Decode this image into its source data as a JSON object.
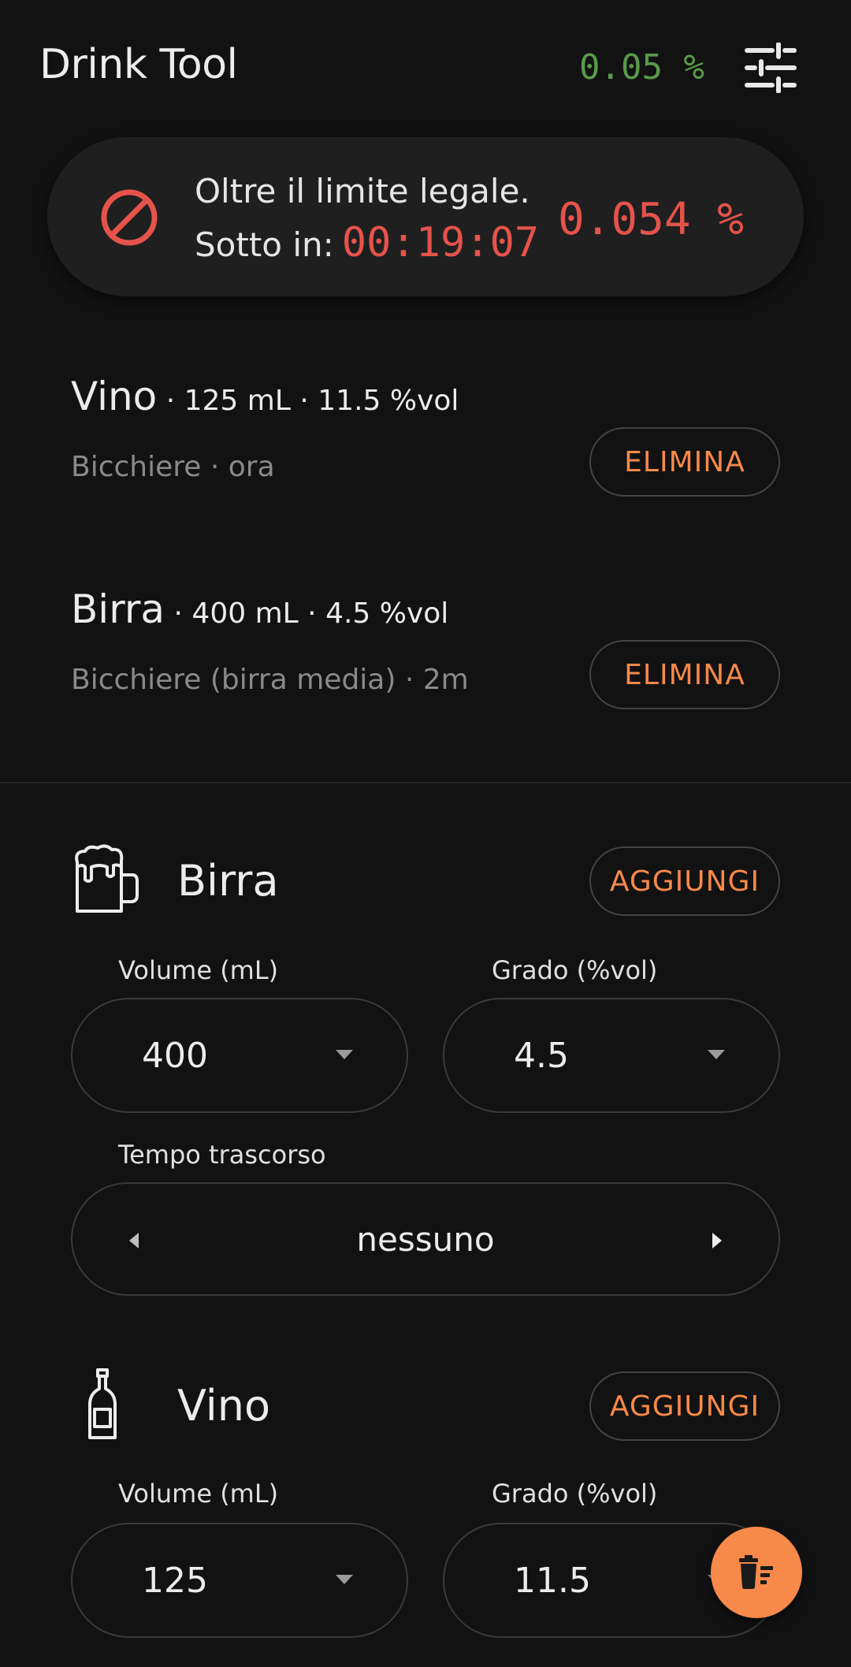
{
  "header": {
    "title": "Drink Tool",
    "bac": "0.05 %"
  },
  "status": {
    "line1": "Oltre il limite legale.",
    "line2_label": "Sotto in:",
    "timer": "00:19:07",
    "bac": "0.054 %",
    "color": "#e5534b"
  },
  "log": [
    {
      "name": "Vino",
      "volume": "125",
      "unit": "mL",
      "abv": "11.5 %vol",
      "subtitle": "Bicchiere · ora",
      "delete_label": "ELIMINA"
    },
    {
      "name": "Birra",
      "volume": "400",
      "unit": "mL",
      "abv": "4.5 %vol",
      "subtitle": "Bicchiere (birra media) · 2m",
      "delete_label": "ELIMINA"
    }
  ],
  "beer": {
    "title": "Birra",
    "add_label": "AGGIUNGI",
    "volume_label": "Volume (mL)",
    "volume_value": "400",
    "abv_label": "Grado (%vol)",
    "abv_value": "4.5",
    "elapsed_label": "Tempo trascorso",
    "elapsed_value": "nessuno",
    "icon": "beer-mug-icon"
  },
  "wine": {
    "title": "Vino",
    "add_label": "AGGIUNGI",
    "volume_label": "Volume (mL)",
    "volume_value": "125",
    "abv_label": "Grado (%vol)",
    "abv_value": "11.5",
    "icon": "wine-bottle-icon"
  },
  "colors": {
    "accent": "#f7894a",
    "ok": "#5a9a4a",
    "danger": "#e5534b",
    "background": "#121212"
  }
}
